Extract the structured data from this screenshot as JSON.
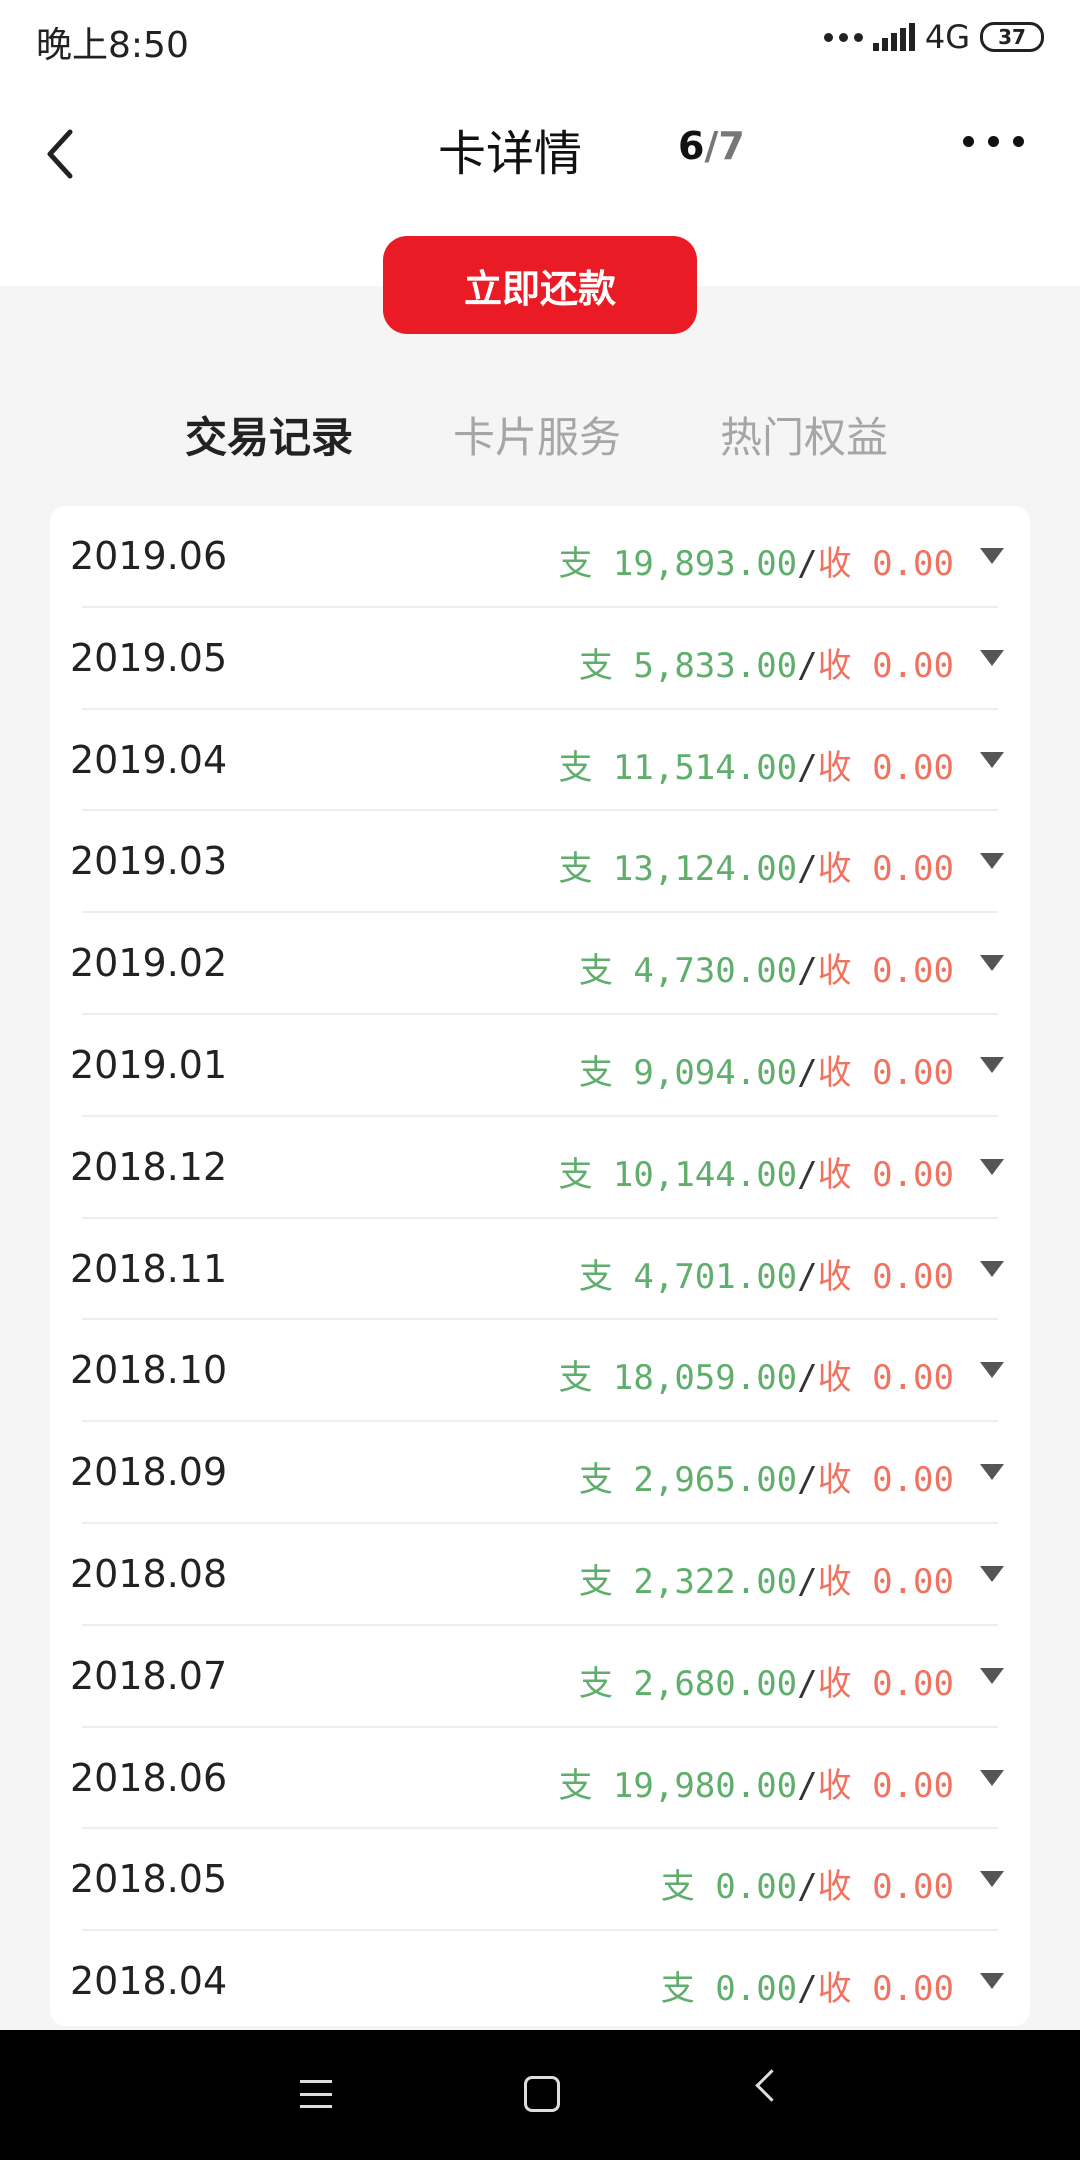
{
  "status": {
    "time": "晚上8:50",
    "network": "4G",
    "battery": "37"
  },
  "header": {
    "title": "卡详情",
    "page_current": "6",
    "page_total": "/7"
  },
  "pay_button": "立即还款",
  "tabs": [
    {
      "label": "交易记录",
      "active": true
    },
    {
      "label": "卡片服务",
      "active": false
    },
    {
      "label": "热门权益",
      "active": false
    }
  ],
  "records": [
    {
      "month": "2019.06",
      "expense": "支 19,893.00",
      "sep": "/",
      "income": "收 0.00"
    },
    {
      "month": "2019.05",
      "expense": "支 5,833.00",
      "sep": "/",
      "income": "收 0.00"
    },
    {
      "month": "2019.04",
      "expense": "支 11,514.00",
      "sep": "/",
      "income": "收 0.00"
    },
    {
      "month": "2019.03",
      "expense": "支 13,124.00",
      "sep": "/",
      "income": "收 0.00"
    },
    {
      "month": "2019.02",
      "expense": "支 4,730.00",
      "sep": "/",
      "income": "收 0.00"
    },
    {
      "month": "2019.01",
      "expense": "支 9,094.00",
      "sep": "/",
      "income": "收 0.00"
    },
    {
      "month": "2018.12",
      "expense": "支 10,144.00",
      "sep": "/",
      "income": "收 0.00"
    },
    {
      "month": "2018.11",
      "expense": "支 4,701.00",
      "sep": "/",
      "income": "收 0.00"
    },
    {
      "month": "2018.10",
      "expense": "支 18,059.00",
      "sep": "/",
      "income": "收 0.00"
    },
    {
      "month": "2018.09",
      "expense": "支 2,965.00",
      "sep": "/",
      "income": "收 0.00"
    },
    {
      "month": "2018.08",
      "expense": "支 2,322.00",
      "sep": "/",
      "income": "收 0.00"
    },
    {
      "month": "2018.07",
      "expense": "支 2,680.00",
      "sep": "/",
      "income": "收 0.00"
    },
    {
      "month": "2018.06",
      "expense": "支 19,980.00",
      "sep": "/",
      "income": "收 0.00"
    },
    {
      "month": "2018.05",
      "expense": "支 0.00",
      "sep": "/",
      "income": "收 0.00"
    },
    {
      "month": "2018.04",
      "expense": "支 0.00",
      "sep": "/",
      "income": "收 0.00"
    }
  ],
  "colors": {
    "accent": "#ea1b24",
    "expense": "#5fae6c",
    "income": "#f07360"
  }
}
